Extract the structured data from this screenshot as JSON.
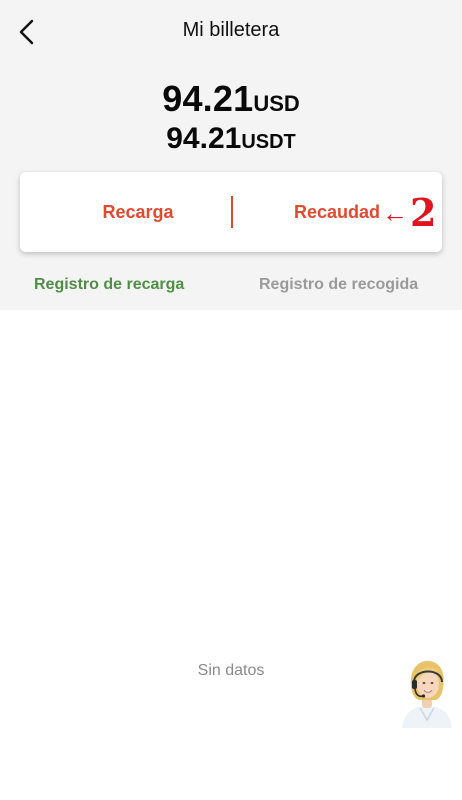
{
  "header": {
    "title": "Mi billetera",
    "back_icon": "chevron-left-icon"
  },
  "balance": {
    "usd_value": "94.21",
    "usd_currency": "USD",
    "usdt_value": "94.21",
    "usdt_currency": "USDT"
  },
  "actions": {
    "recharge_label": "Recarga",
    "collect_label": "Recaudad"
  },
  "annotation": {
    "arrow": "←",
    "number": "2"
  },
  "tabs": [
    {
      "label": "Registro de recarga",
      "active": true
    },
    {
      "label": "Registro de recogida",
      "active": false
    }
  ],
  "empty_state": {
    "text": "Sin datos"
  },
  "support": {
    "icon": "customer-support-avatar-icon"
  },
  "colors": {
    "accent": "#e04a2f",
    "active_tab": "#4f8f45",
    "inactive_tab": "#9a9a9a",
    "annotation": "#e0141e",
    "header_background": "#f4f4f4"
  }
}
